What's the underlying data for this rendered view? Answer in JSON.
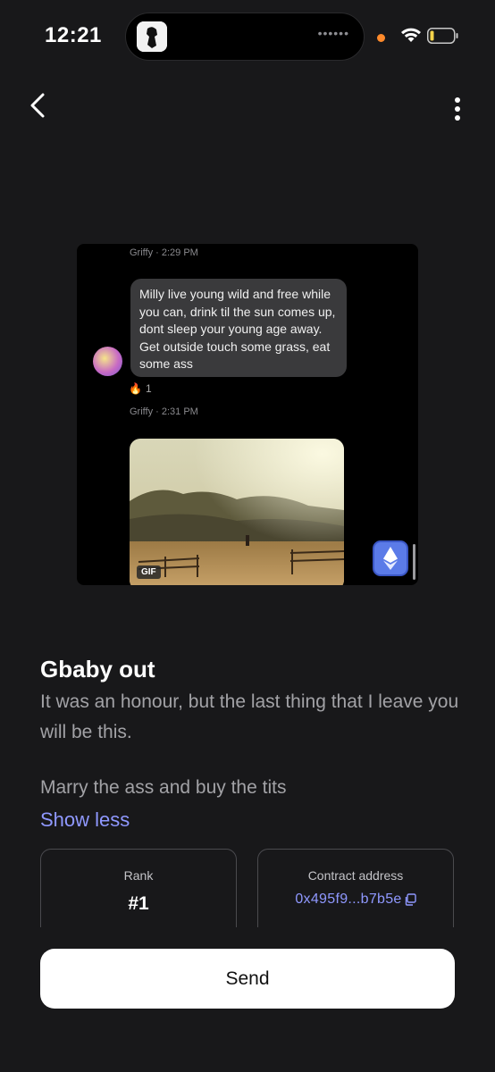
{
  "status_bar": {
    "time": "12:21",
    "island_indicator": "••••••",
    "icons": [
      "wifi-icon",
      "battery-icon"
    ]
  },
  "nav": {
    "back_icon": "chevron-left-icon",
    "more_icon": "more-vertical-icon"
  },
  "nft_image": {
    "chat": {
      "timestamp_1": "Griffy · 2:29 PM",
      "message": "Milly live young wild and free while you can, drink til the sun comes up, dont sleep your young age away. Get outside touch some grass, eat some ass",
      "reaction_emoji": "🔥",
      "reaction_count": "1",
      "timestamp_2": "Griffy · 2:31 PM",
      "gif_label": "GIF"
    },
    "chain_icon": "ethereum-icon"
  },
  "details": {
    "title": "Gbaby out",
    "description": "It was an honour, but the last thing that I leave you will be this.",
    "description_more": "Marry the ass and buy the tits",
    "toggle_label": "Show less"
  },
  "cards": {
    "rank_label": "Rank",
    "rank_value": "#1",
    "contract_label": "Contract address",
    "contract_value": "0x495f9...b7b5e"
  },
  "actions": {
    "send_label": "Send"
  },
  "colors": {
    "background": "#18181a",
    "accent": "#8f98ff",
    "button": "#ffffff"
  }
}
